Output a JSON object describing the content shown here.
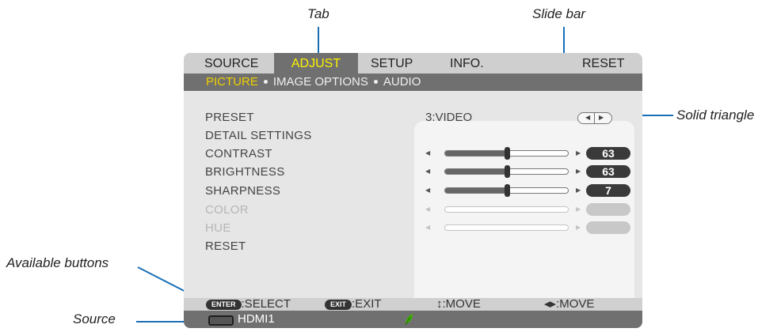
{
  "callouts": {
    "tab": "Tab",
    "slide_bar": "Slide bar",
    "solid_triangle": "Solid triangle",
    "available_buttons": "Available buttons",
    "source": "Source"
  },
  "menu": {
    "tabs": [
      {
        "label": "SOURCE",
        "active": false
      },
      {
        "label": "ADJUST",
        "active": true
      },
      {
        "label": "SETUP",
        "active": false
      },
      {
        "label": "INFO.",
        "active": false
      },
      {
        "label": "RESET",
        "active": false
      }
    ],
    "subtabs": [
      {
        "label": "PICTURE",
        "current": true
      },
      {
        "label": "IMAGE OPTIONS",
        "current": false
      },
      {
        "label": "AUDIO",
        "current": false
      }
    ],
    "items": [
      {
        "label": "PRESET"
      },
      {
        "label": "DETAIL SETTINGS"
      },
      {
        "label": "CONTRAST"
      },
      {
        "label": "BRIGHTNESS"
      },
      {
        "label": "SHARPNESS"
      },
      {
        "label": "COLOR",
        "disabled": true
      },
      {
        "label": "HUE",
        "disabled": true
      },
      {
        "label": "RESET"
      }
    ],
    "preset_value": "3:VIDEO",
    "sliders": [
      {
        "name": "contrast",
        "value": "63",
        "level": 0.5,
        "enabled": true
      },
      {
        "name": "brightness",
        "value": "63",
        "level": 0.5,
        "enabled": true
      },
      {
        "name": "sharpness",
        "value": "7",
        "level": 0.5,
        "enabled": true
      },
      {
        "name": "color",
        "value": "",
        "level": null,
        "enabled": false
      },
      {
        "name": "hue",
        "value": "",
        "level": null,
        "enabled": false
      }
    ],
    "buttons_bar": {
      "enter_badge": "ENTER",
      "select": ":SELECT",
      "exit_badge": "EXIT",
      "exit": ":EXIT",
      "move_ud": "↕:MOVE",
      "move_lr": "◂▸:MOVE"
    },
    "source": {
      "label": "HDMI1",
      "eco_icon": "leaf-icon"
    }
  },
  "colors": {
    "accent_line": "#1a6fb5",
    "active_tab_text": "#fff200",
    "current_subtab_text": "#f0d000",
    "eco_leaf": "#3cb000"
  }
}
